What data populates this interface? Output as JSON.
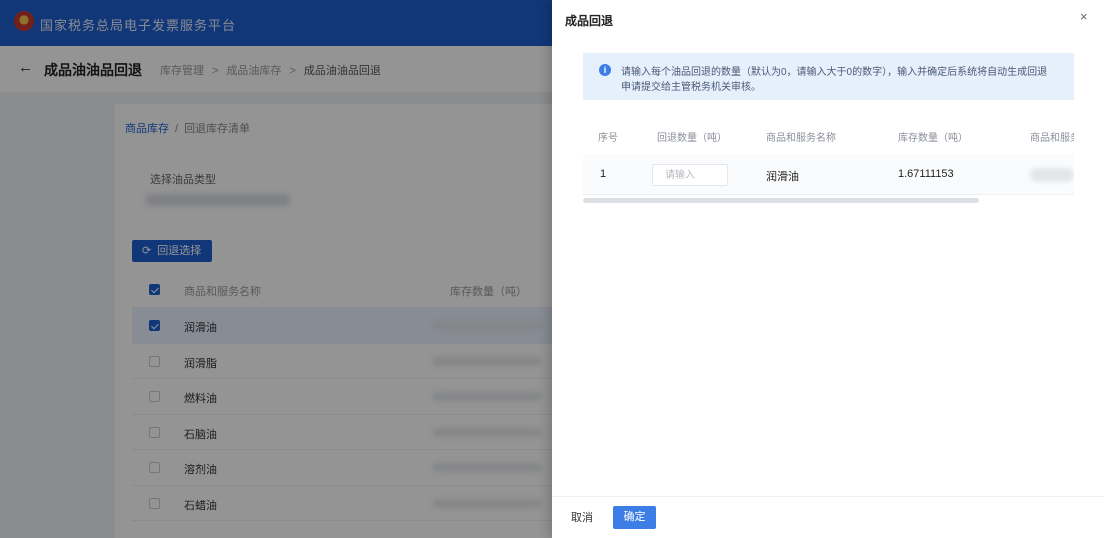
{
  "header": {
    "app_title": "国家税务总局电子发票服务平台"
  },
  "page": {
    "back_label": "←",
    "title": "成品油油品回退",
    "breadcrumb": [
      "库存管理",
      "成品油库存",
      "成品油油品回退"
    ],
    "breadcrumb_sep": ">"
  },
  "card": {
    "tabs": [
      "商品库存",
      "回退库存清单"
    ],
    "tab_sep": "/",
    "field_label": "选择油品类型",
    "action_button": {
      "icon": "refresh-icon",
      "label": "回退选择"
    },
    "table": {
      "columns": [
        "商品和服务名称",
        "库存数量（吨）"
      ],
      "header_checked": true,
      "rows": [
        {
          "name": "润滑油",
          "checked": true
        },
        {
          "name": "润滑脂",
          "checked": false
        },
        {
          "name": "燃料油",
          "checked": false
        },
        {
          "name": "石脑油",
          "checked": false
        },
        {
          "name": "溶剂油",
          "checked": false
        },
        {
          "name": "石蜡油",
          "checked": false
        }
      ]
    }
  },
  "drawer": {
    "title": "成品回退",
    "close_label": "×",
    "notice": {
      "icon": "info-icon",
      "lines": [
        "请输入每个油品回退的数量（默认为0，请输入大于0的数字），输入并确定后系统将自动生成回退",
        "申请提交给主管税务机关审核。"
      ]
    },
    "table": {
      "columns": [
        "序号",
        "回退数量（吨）",
        "商品和服务名称",
        "库存数量（吨）",
        "商品和服务编码"
      ],
      "rows": [
        {
          "index": "1",
          "qty_placeholder": "请输入",
          "name": "润滑油",
          "stock": "1.67111153"
        }
      ]
    },
    "cancel_label": "取消",
    "confirm_label": "确定"
  },
  "colors": {
    "header_blue": "#1f5fd1",
    "primary_button": "#3d7ee6",
    "notice_bg": "#e6f0fd",
    "mask": "rgba(0,0,0,0.42)"
  }
}
